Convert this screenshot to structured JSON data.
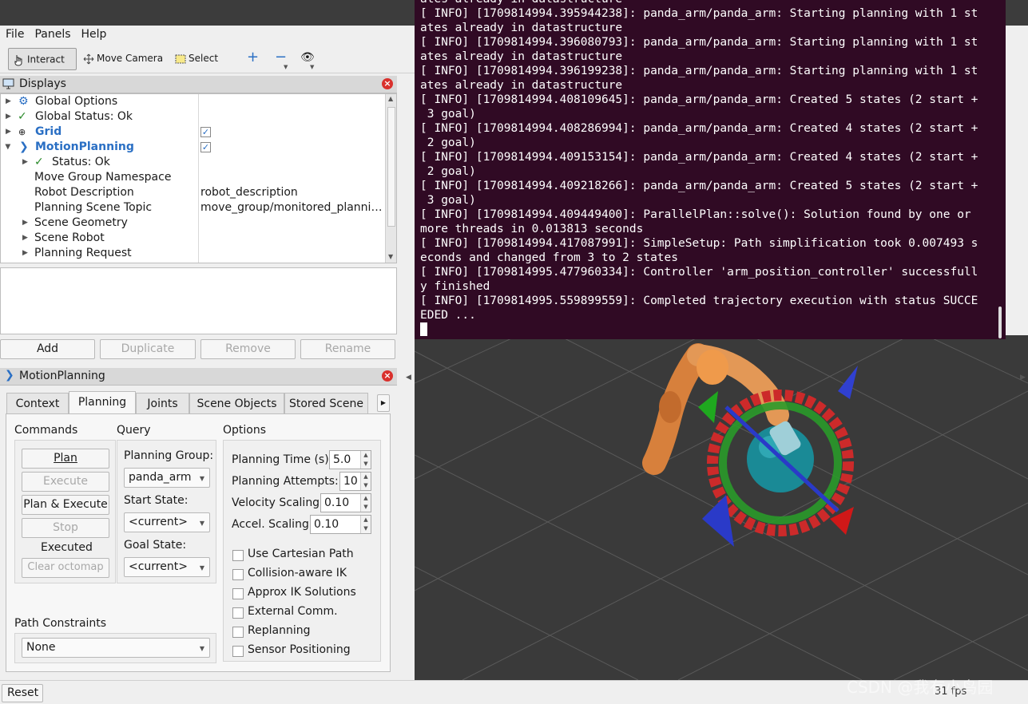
{
  "menu": {
    "file": "File",
    "panels": "Panels",
    "help": "Help"
  },
  "toolbar": {
    "interact": "Interact",
    "move_camera": "Move Camera",
    "select": "Select"
  },
  "displays": {
    "title": "Displays",
    "rows": [
      {
        "label": "Global Options"
      },
      {
        "label": "Global Status: Ok"
      },
      {
        "label": "Grid"
      },
      {
        "label": "MotionPlanning"
      },
      {
        "label": "Status: Ok"
      },
      {
        "label": "Move Group Namespace"
      },
      {
        "label": "Robot Description",
        "value": "robot_description"
      },
      {
        "label": "Planning Scene Topic",
        "value": "move_group/monitored_planning_scene"
      },
      {
        "label": "Scene Geometry"
      },
      {
        "label": "Scene Robot"
      },
      {
        "label": "Planning Request"
      }
    ],
    "buttons": {
      "add": "Add",
      "duplicate": "Duplicate",
      "remove": "Remove",
      "rename": "Rename"
    }
  },
  "motion_planning": {
    "title": "MotionPlanning",
    "tabs": [
      "Context",
      "Planning",
      "Joints",
      "Scene Objects",
      "Stored Scene"
    ],
    "commands": {
      "heading": "Commands",
      "plan": "Plan",
      "execute": "Execute",
      "plan_execute": "Plan & Execute",
      "stop": "Stop",
      "status": "Executed",
      "clear_octomap": "Clear octomap"
    },
    "query": {
      "heading": "Query",
      "planning_group_label": "Planning Group:",
      "planning_group": "panda_arm",
      "start_state_label": "Start State:",
      "start_state": "<current>",
      "goal_state_label": "Goal State:",
      "goal_state": "<current>"
    },
    "options": {
      "heading": "Options",
      "planning_time_label": "Planning Time (s):",
      "planning_time": "5.0",
      "planning_attempts_label": "Planning Attempts:",
      "planning_attempts": "10",
      "velocity_scaling_label": "Velocity Scaling:",
      "velocity_scaling": "0.10",
      "accel_scaling_label": "Accel. Scaling:",
      "accel_scaling": "0.10",
      "checkboxes": [
        "Use Cartesian Path",
        "Collision-aware IK",
        "Approx IK Solutions",
        "External Comm.",
        "Replanning",
        "Sensor Positioning"
      ]
    },
    "path_constraints": {
      "label": "Path Constraints",
      "value": "None"
    }
  },
  "terminal": {
    "lines": [
      "ates already in datastructure",
      "[ INFO] [1709814994.395944238]: panda_arm/panda_arm: Starting planning with 1 st",
      "ates already in datastructure",
      "[ INFO] [1709814994.396080793]: panda_arm/panda_arm: Starting planning with 1 st",
      "ates already in datastructure",
      "[ INFO] [1709814994.396199238]: panda_arm/panda_arm: Starting planning with 1 st",
      "ates already in datastructure",
      "[ INFO] [1709814994.408109645]: panda_arm/panda_arm: Created 5 states (2 start +",
      " 3 goal)",
      "[ INFO] [1709814994.408286994]: panda_arm/panda_arm: Created 4 states (2 start +",
      " 2 goal)",
      "[ INFO] [1709814994.409153154]: panda_arm/panda_arm: Created 4 states (2 start +",
      " 2 goal)",
      "[ INFO] [1709814994.409218266]: panda_arm/panda_arm: Created 5 states (2 start +",
      " 3 goal)",
      "[ INFO] [1709814994.409449400]: ParallelPlan::solve(): Solution found by one or",
      "more threads in 0.013813 seconds",
      "[ INFO] [1709814994.417087991]: SimpleSetup: Path simplification took 0.007493 s",
      "econds and changed from 3 to 2 states",
      "[ INFO] [1709814995.477960334]: Controller 'arm_position_controller' successfull",
      "y finished",
      "[ INFO] [1709814995.559899559]: Completed trajectory execution with status SUCCE",
      "EDED ..."
    ]
  },
  "status": {
    "reset": "Reset",
    "fps": "31 fps",
    "watermark": "CSDN @我有小鸟园"
  },
  "colors": {
    "terminal_bg": "#300a24",
    "viewport_bg": "#3a3a3a",
    "accent_blue": "#2a6fc4"
  }
}
